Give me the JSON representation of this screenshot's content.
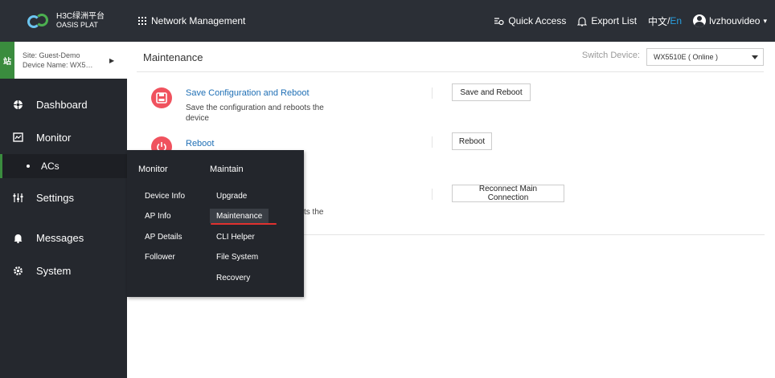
{
  "topbar": {
    "logo_line1": "H3C绿洲平台",
    "logo_line2": "OASIS PLAT",
    "nav_title": "Network Management",
    "quick_access": "Quick Access",
    "export_list": "Export List",
    "lang_zh": "中文",
    "lang_sep": " / ",
    "lang_en": "En",
    "username": "lvzhouvideo"
  },
  "site": {
    "icon_text": "站",
    "site_line": "Site: Guest-Demo",
    "device_line": "Device Name: WX5…"
  },
  "sidebar": {
    "items": [
      {
        "label": "Dashboard",
        "icon": "dashboard-icon"
      },
      {
        "label": "Monitor",
        "icon": "monitor-icon"
      },
      {
        "label": "ACs",
        "icon": "dot"
      },
      {
        "label": "Settings",
        "icon": "settings-icon"
      },
      {
        "label": "Messages",
        "icon": "bell-icon"
      },
      {
        "label": "System",
        "icon": "gear-icon"
      }
    ]
  },
  "main": {
    "title": "Maintenance",
    "switch_label": "Switch Device:",
    "switch_value": "WX5510E ( Online )",
    "operations": [
      {
        "title": "Save Configuration and Reboot",
        "desc_line1": "Save the configuration and reboots the",
        "desc_line2": "device",
        "button": "Save and Reboot"
      },
      {
        "title": "Reboot",
        "button": "Reboot"
      },
      {
        "desc_fragment": "ts the",
        "button": "Reconnect Main Connection"
      }
    ]
  },
  "flyout": {
    "col1_header": "Monitor",
    "col2_header": "Maintain",
    "col1_items": [
      "Device Info",
      "AP Info",
      "AP Details",
      "Follower"
    ],
    "col2_items": [
      "Upgrade",
      "Maintenance",
      "CLI Helper",
      "File System",
      "Recovery"
    ]
  },
  "colors": {
    "topbar_bg": "#2b2f36",
    "sidebar_bg": "#25282e",
    "accent_green": "#3a8c3e",
    "link_blue": "#1f6fb5",
    "icon_red": "#f0525e",
    "underline_red": "#e0312f"
  }
}
